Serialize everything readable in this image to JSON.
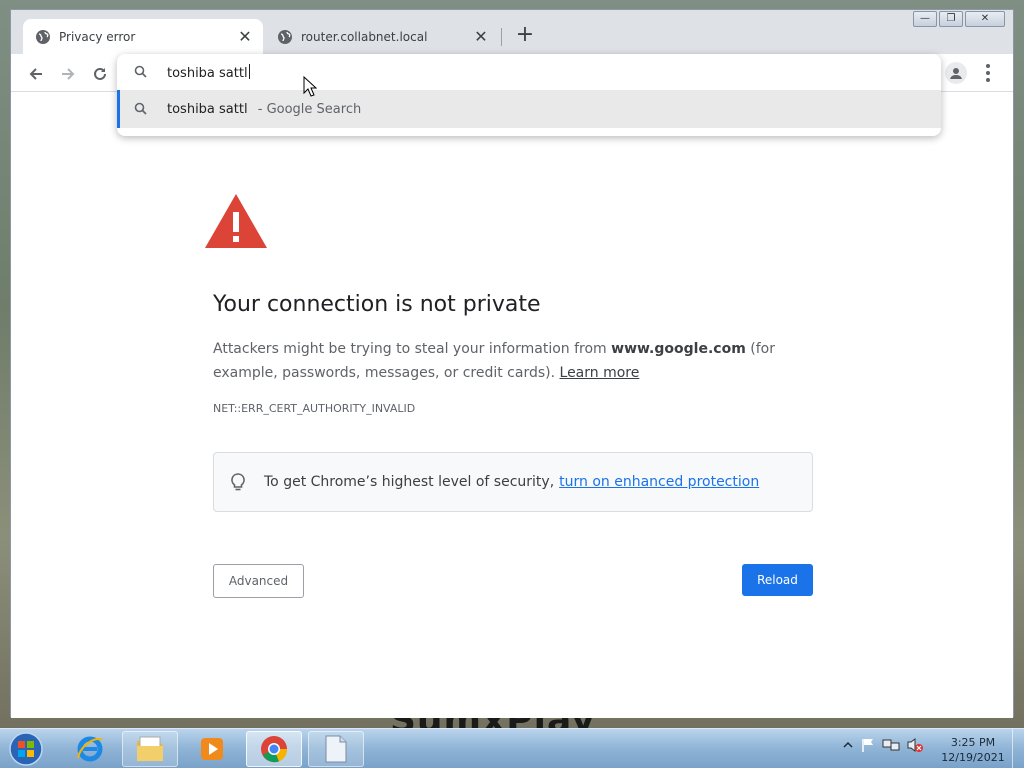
{
  "wallpaper": {
    "text": "SumxPlay"
  },
  "browser": {
    "tabs": [
      {
        "title": "Privacy error",
        "icon": "globe-icon",
        "active": true
      },
      {
        "title": "router.collabnet.local",
        "icon": "globe-icon",
        "active": false
      }
    ],
    "new_tab_label": "+",
    "omnibox": {
      "typed_text": "toshiba sattl",
      "suggestion": {
        "query": "toshiba sattl",
        "separator": "-",
        "engine": "Google Search"
      }
    }
  },
  "page": {
    "heading": "Your connection is not private",
    "description_part1": "Attackers might be trying to steal your information from ",
    "domain": "www.google.com",
    "description_part2": " (for example, passwords, messages, or credit cards). ",
    "learn_more": "Learn more",
    "error_code": "NET::ERR_CERT_AUTHORITY_INVALID",
    "security_text": "To get Chrome’s highest level of security,",
    "security_link": "turn on enhanced protection",
    "advanced_button": "Advanced",
    "reload_button": "Reload",
    "colors": {
      "warning": "#db4437",
      "primary": "#1a73e8"
    }
  },
  "taskbar": {
    "pinned": [
      "internet-explorer-icon",
      "folder-icon",
      "media-player-icon",
      "chrome-icon",
      "notepad-icon"
    ],
    "clock": {
      "time": "3:25 PM",
      "date": "12/19/2021"
    }
  }
}
